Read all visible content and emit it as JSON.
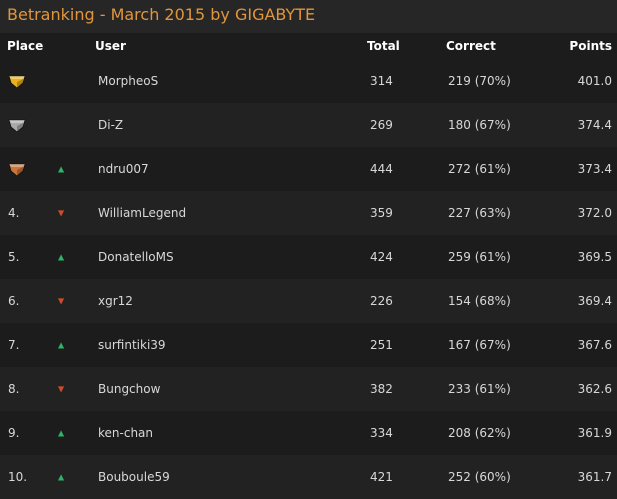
{
  "title": "Betranking - March 2015 by GIGABYTE",
  "columns": {
    "place": "Place",
    "user": "User",
    "total": "Total",
    "correct": "Correct",
    "points": "Points"
  },
  "colors": {
    "title": "#e1963c",
    "trend_up": "#2fb36a",
    "trend_down": "#d24b2b",
    "gold": "#e8b21c",
    "silver": "#a9a9a9",
    "bronze": "#c9763a"
  },
  "rows": [
    {
      "place": "",
      "medal": "gold-trophy-icon",
      "trend": "",
      "user": "MorpheoS",
      "total": "314",
      "correct": "219 (70%)",
      "points": "401.0"
    },
    {
      "place": "",
      "medal": "silver-trophy-icon",
      "trend": "",
      "user": "Di-Z",
      "total": "269",
      "correct": "180 (67%)",
      "points": "374.4"
    },
    {
      "place": "",
      "medal": "bronze-trophy-icon",
      "trend": "up",
      "user": "ndru007",
      "total": "444",
      "correct": "272 (61%)",
      "points": "373.4"
    },
    {
      "place": "4.",
      "medal": "",
      "trend": "down",
      "user": "WilliamLegend",
      "total": "359",
      "correct": "227 (63%)",
      "points": "372.0"
    },
    {
      "place": "5.",
      "medal": "",
      "trend": "up",
      "user": "DonatelloMS",
      "total": "424",
      "correct": "259 (61%)",
      "points": "369.5"
    },
    {
      "place": "6.",
      "medal": "",
      "trend": "down",
      "user": "xgr12",
      "total": "226",
      "correct": "154 (68%)",
      "points": "369.4"
    },
    {
      "place": "7.",
      "medal": "",
      "trend": "up",
      "user": "surfintiki39",
      "total": "251",
      "correct": "167 (67%)",
      "points": "367.6"
    },
    {
      "place": "8.",
      "medal": "",
      "trend": "down",
      "user": "Bungchow",
      "total": "382",
      "correct": "233 (61%)",
      "points": "362.6"
    },
    {
      "place": "9.",
      "medal": "",
      "trend": "up",
      "user": "ken-chan",
      "total": "334",
      "correct": "208 (62%)",
      "points": "361.9"
    },
    {
      "place": "10.",
      "medal": "",
      "trend": "up",
      "user": "Bouboule59",
      "total": "421",
      "correct": "252 (60%)",
      "points": "361.7"
    }
  ]
}
